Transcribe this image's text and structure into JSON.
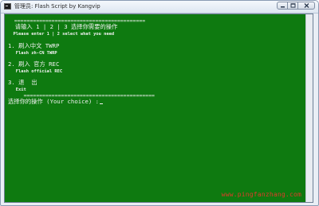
{
  "window": {
    "title": "管理员: Flash Script by Kangvip",
    "buttons": {
      "minimize_icon": "minimize-icon",
      "maximize_icon": "maximize-icon",
      "close_icon": "close-icon"
    }
  },
  "console": {
    "lines": [
      {
        "text": "  ==========================================",
        "style": "sep"
      },
      {
        "text": "  请输入 1 | 2 | 3 选择你需要的操作",
        "style": "cn"
      },
      {
        "text": "  Please enter 1 | 2 select what you need",
        "style": "en"
      },
      {
        "text": "",
        "style": "en"
      },
      {
        "text": "1. 刷入中文 TWRP",
        "style": "cn"
      },
      {
        "text": "   Flash zh-CN TWRP",
        "style": "en"
      },
      {
        "text": "",
        "style": "en"
      },
      {
        "text": "2. 刷入 官方 REC",
        "style": "cn"
      },
      {
        "text": "   Flash official REC",
        "style": "en"
      },
      {
        "text": "",
        "style": "en"
      },
      {
        "text": "3. 退  出",
        "style": "cn"
      },
      {
        "text": "   Exit",
        "style": "en"
      },
      {
        "text": "     ==========================================",
        "style": "sep"
      },
      {
        "text": "选择你的操作 (Your choice) :",
        "style": "cn"
      }
    ]
  },
  "watermark": "www.pingfanzhang.com",
  "colors": {
    "console_bg": "#0e7a10",
    "console_fg": "#f2f2f2",
    "watermark": "#e03a2a"
  }
}
